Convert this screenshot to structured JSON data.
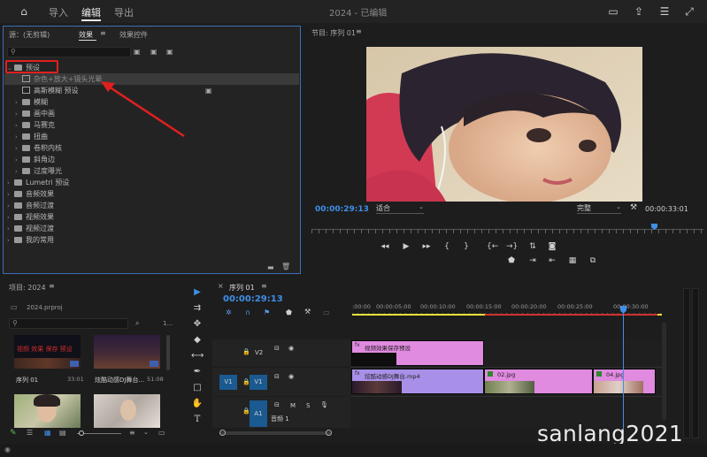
{
  "menubar": {
    "tabs": [
      "导入",
      "编辑",
      "导出"
    ],
    "active_tab": "编辑",
    "document_title": "2024 - 已编辑"
  },
  "effects_panel": {
    "tabs": [
      "源：(无剪辑)",
      "效果",
      "效果控件"
    ],
    "active_tab": "效果",
    "search_value": "",
    "tree": [
      {
        "label": "预设",
        "type": "folder",
        "expanded": true,
        "level": 0
      },
      {
        "label": "杂色+放大+镜头光晕",
        "type": "preset",
        "level": 1,
        "selected": true
      },
      {
        "label": "高斯模糊 预设",
        "type": "preset",
        "level": 1
      },
      {
        "label": "模糊",
        "type": "folder",
        "level": 1
      },
      {
        "label": "画中画",
        "type": "folder",
        "level": 1
      },
      {
        "label": "马赛克",
        "type": "folder",
        "level": 1
      },
      {
        "label": "扭曲",
        "type": "folder",
        "level": 1
      },
      {
        "label": "卷积内核",
        "type": "folder",
        "level": 1
      },
      {
        "label": "斜角边",
        "type": "folder",
        "level": 1
      },
      {
        "label": "过度曝光",
        "type": "folder",
        "level": 1
      },
      {
        "label": "Lumetri 预设",
        "type": "folder",
        "level": 0
      },
      {
        "label": "音频效果",
        "type": "folder",
        "level": 0
      },
      {
        "label": "音频过渡",
        "type": "folder",
        "level": 0
      },
      {
        "label": "视频效果",
        "type": "folder",
        "level": 0
      },
      {
        "label": "视频过渡",
        "type": "folder",
        "level": 0
      },
      {
        "label": "我的常用",
        "type": "folder",
        "level": 0
      }
    ]
  },
  "program_monitor": {
    "title": "节目: 序列 01",
    "current_timecode": "00:00:29:13",
    "duration_timecode": "00:00:33:01",
    "fit_option": "适合",
    "quality_option": "完整"
  },
  "project_panel": {
    "title": "项目: 2024",
    "file_name": "2024.prproj",
    "item_count": "1...",
    "items": [
      {
        "name": "序列 01",
        "duration": "33:01",
        "overlay_text": "视频 效果 保存 预设"
      },
      {
        "name": "炫酷动感DJ舞台...",
        "duration": "51:08"
      },
      {
        "name": "",
        "duration": ""
      },
      {
        "name": "",
        "duration": ""
      }
    ]
  },
  "timeline": {
    "sequence_tab": "序列 01",
    "timecode": "00:00:29:13",
    "ruler_labels": [
      ":00:00",
      "00:00:05:00",
      "00:00:10:00",
      "00:00:15:00",
      "00:00:20:00",
      "00:00:25:00",
      "00:00:30:00"
    ],
    "tracks": {
      "v2": {
        "label": "V2"
      },
      "v1": {
        "label": "V1",
        "source": "V1"
      },
      "a1": {
        "label": "A1",
        "name": "音频 1",
        "mute": "M",
        "solo": "S"
      }
    },
    "clips": {
      "v2_clip": "视频效果保存预设",
      "v1_clip1": "炫酷动感DJ舞台.mp4",
      "v1_clip2": "02.jpg",
      "v1_clip3": "04.jpg"
    }
  },
  "watermark": "sanlang2021",
  "colors": {
    "accent_blue": "#3f8fe8",
    "clip_purple": "#a890e8",
    "clip_pink": "#e08ae0",
    "highlight_red": "#e02020"
  }
}
